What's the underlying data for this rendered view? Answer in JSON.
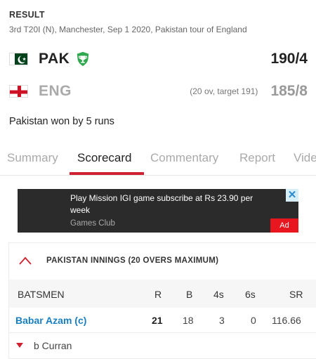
{
  "match": {
    "status_label": "RESULT",
    "info": "3rd T20I (N), Manchester, Sep 1 2020, Pakistan tour of England",
    "result": "Pakistan won by 5 runs"
  },
  "teams": [
    {
      "name": "PAK",
      "score": "190/4",
      "winner": true
    },
    {
      "name": "ENG",
      "note": "(20 ov, target 191)",
      "score": "185/8"
    }
  ],
  "tabs": [
    "Summary",
    "Scorecard",
    "Commentary",
    "Report",
    "Vide"
  ],
  "active_tab": "Scorecard",
  "ad": {
    "title": "Play Mission IGI game subscribe at Rs 23.90 per week",
    "source": "Games Club",
    "badge": "Ad",
    "close": "✕"
  },
  "innings": {
    "title": "PAKISTAN INNINGS (20 OVERS MAXIMUM)",
    "columns": [
      "BATSMEN",
      "R",
      "B",
      "4s",
      "6s",
      "SR"
    ],
    "batsmen": [
      {
        "name": "Babar Azam (c)",
        "r": "21",
        "b": "18",
        "fours": "3",
        "sixes": "0",
        "sr": "116.66",
        "dismissal": "b Curran"
      }
    ]
  },
  "colors": {
    "accent": "#d1202f",
    "link": "#1a7fc1",
    "winner_badge": "#2fa84f",
    "pak_green": "#01411c"
  },
  "icons": {
    "winner": "trophy-icon",
    "collapse": "chevron-up-icon",
    "expand": "chevron-down-icon"
  }
}
